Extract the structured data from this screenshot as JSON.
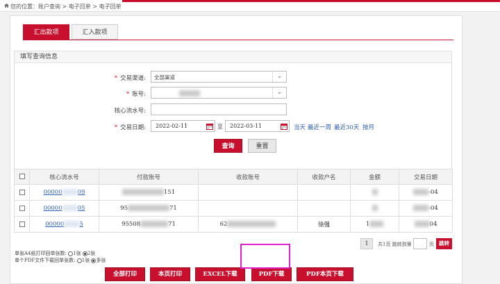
{
  "breadcrumb": {
    "text": "您的位置：账户查询 > 电子回单 > 电子回单"
  },
  "tabs": [
    {
      "label": "汇出款项",
      "active": true
    },
    {
      "label": "汇入款项",
      "active": false
    }
  ],
  "form": {
    "title": "填写查询信息",
    "channel": {
      "label": "交易渠道:",
      "value": "全部渠道"
    },
    "account": {
      "label": "账号:"
    },
    "serial": {
      "label": "核心流水号:"
    },
    "date": {
      "label": "交易日期:",
      "from": "2022-02-11",
      "sep": "至",
      "to": "2022-03-11",
      "quick": [
        "当天",
        "最近一周",
        "最近30天",
        "按月"
      ]
    },
    "buttons": {
      "query": "查询",
      "reset": "重置"
    }
  },
  "table": {
    "headers": [
      "核心流水号",
      "付款账号",
      "收款账号",
      "收款户名",
      "金额",
      "交易日期"
    ],
    "rows": [
      {
        "serial": "00000",
        "serial_tail": "09",
        "payer": "151",
        "payee": "",
        "name": "",
        "amount": "",
        "date": "-04"
      },
      {
        "serial": "00000",
        "serial_tail": "05",
        "payer": "95",
        "payer_tail": "71",
        "payee": "",
        "name": "",
        "amount": "",
        "date": "-04"
      },
      {
        "serial": "00000",
        "serial_tail": "5",
        "payer": "95508",
        "payer_tail": "71",
        "payee": "62",
        "name": "徐强",
        "amount": "1",
        "date": "04"
      }
    ]
  },
  "pager": {
    "page": "1",
    "text": "共1页 跳转到第",
    "page_unit": "页",
    "go": "跳转"
  },
  "options": {
    "a4": {
      "label": "单张A4纸打印回单张数:",
      "opt1": "1张",
      "opt2": "2张"
    },
    "pdf": {
      "label": "单个PDF文件下载回单张数:",
      "opt1": "1张",
      "opt2": "多张"
    }
  },
  "actions": {
    "print_all": "全部打印",
    "print_page": "本页打印",
    "excel": "EXCEL下载",
    "pdf": "PDF下载",
    "pdf_page": "PDF本页下载"
  },
  "colors": {
    "brand_red": "#c8102e",
    "link_blue": "#2a5db0",
    "highlight_magenta": "#e020c9"
  }
}
